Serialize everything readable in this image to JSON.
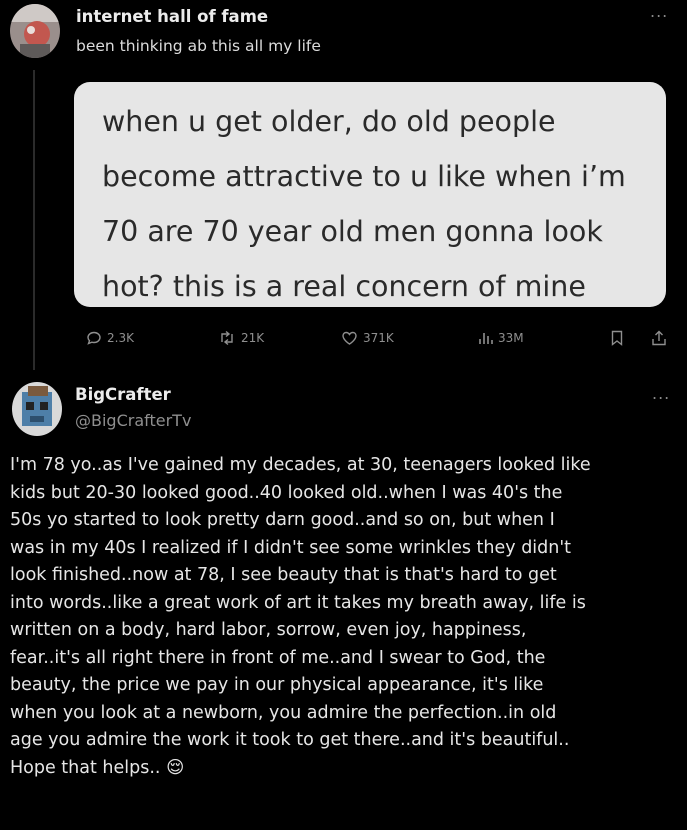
{
  "post": {
    "account_name": "internet hall of fame",
    "caption": "been thinking ab this all my life",
    "more_label": "...",
    "bubble_lines": [
      "when u get older, do old people",
      "become attractive to u like when i’m",
      "70 are 70 year old men gonna look",
      "hot? this is a real concern of mine"
    ],
    "actions": {
      "replies": "2.3K",
      "reposts": "21K",
      "likes": "371K",
      "views": "33M"
    }
  },
  "reply": {
    "display_name": "BigCrafter",
    "handle": "@BigCrafterTv",
    "more_label": "...",
    "lines": [
      "I'm 78 yo..as I've gained my decades, at 30, teenagers looked like",
      "kids but 20-30 looked good..40 looked old..when I was 40's the",
      "50s yo started to look pretty darn good..and so on, but when I",
      "was in my 40s I realized if I didn't see some wrinkles they didn't",
      "look finished..now at 78, I see beauty that is that's hard to get",
      "into words..like a great work of art it takes my breath away, life is",
      "written on a body, hard labor, sorrow, even joy, happiness,",
      "fear..it's all right there in front of me..and I swear to God,  the",
      "beauty, the price we pay in our physical appearance, it's like",
      "when you look at a newborn, you admire the perfection..in old",
      "age you admire the work it took to get there..and it's beautiful..",
      "Hope that helps.."
    ],
    "emoji": "😌"
  },
  "colors": {
    "background": "#000000",
    "bubble": "#e6e6e6",
    "muted": "#8f8f8f"
  }
}
